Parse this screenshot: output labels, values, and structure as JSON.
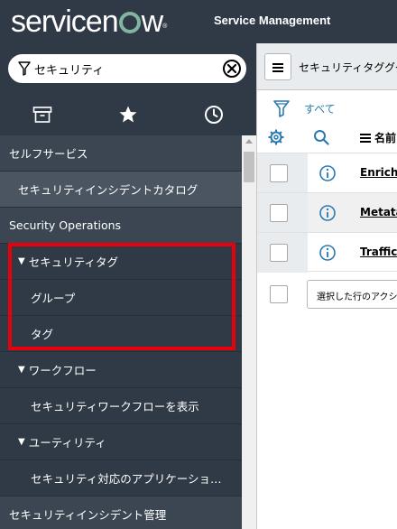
{
  "header": {
    "logo_text": "servicenow",
    "title": "Service Management"
  },
  "nav": {
    "filter": {
      "value": "セキュリティ",
      "icon": "funnel-icon",
      "clear_icon": "clear-circle-x-icon"
    },
    "tabs": [
      {
        "icon": "archive-box-icon"
      },
      {
        "icon": "star-icon"
      },
      {
        "icon": "clock-icon"
      }
    ],
    "items": [
      {
        "label": "セルフサービス",
        "type": "section"
      },
      {
        "label": "セキュリティインシデントカタログ",
        "type": "catalog"
      },
      {
        "label": "Security Operations",
        "type": "section"
      },
      {
        "label": "セキュリティタグ",
        "type": "group",
        "caret": "▼"
      },
      {
        "label": "グループ",
        "type": "sub"
      },
      {
        "label": "タグ",
        "type": "sub"
      },
      {
        "label": "ワークフロー",
        "type": "group",
        "caret": "▼"
      },
      {
        "label": "セキュリティワークフローを表示",
        "type": "sub"
      },
      {
        "label": "ユーティリティ",
        "type": "group",
        "caret": "▼"
      },
      {
        "label": "セキュリティ対応のアプリケーションレ…",
        "type": "sub"
      },
      {
        "label": "セキュリティインシデント管理",
        "type": "section"
      }
    ],
    "highlight_color": "#e8000c"
  },
  "content": {
    "title": "セキュリティタグググル",
    "filter_all": "すべて",
    "column_name": "名前",
    "rows": [
      {
        "name": "Enrichme"
      },
      {
        "name": "Metatag"
      },
      {
        "name": "Traffic L"
      }
    ],
    "action_placeholder": "選択した行のアクション"
  },
  "colors": {
    "nav_bg": "#303a46",
    "accent": "#81b5a1",
    "link": "#2a7ab0"
  }
}
